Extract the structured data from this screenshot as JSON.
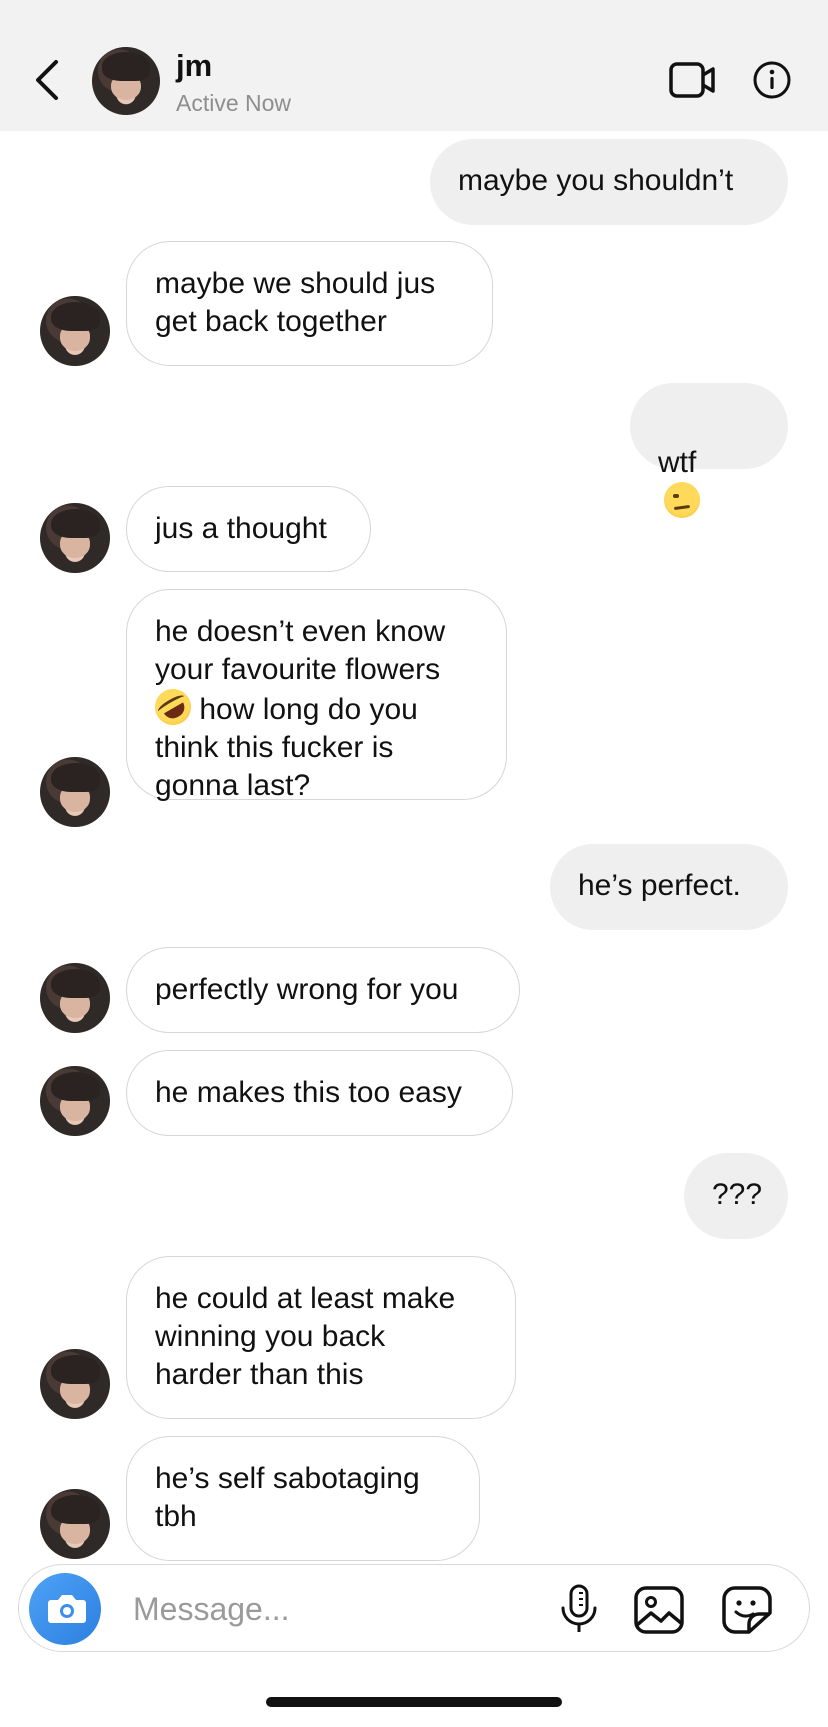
{
  "header": {
    "contact_name": "jm",
    "contact_status": "Active Now",
    "back_icon": "chevron-left-icon",
    "video_icon": "video-camera-icon",
    "info_icon": "info-icon"
  },
  "messages": [
    {
      "direction": "outgoing",
      "text": "maybe you shouldn’t"
    },
    {
      "direction": "incoming",
      "text": "maybe we should jus\nget back together"
    },
    {
      "direction": "outgoing",
      "text": "wtf",
      "emoji": "raised-eyebrow-emoji"
    },
    {
      "direction": "incoming",
      "text": "jus a thought"
    },
    {
      "direction": "incoming",
      "text_before_emoji": "he doesn’t even know\nyour favourite flowers\n",
      "emoji": "rofl-emoji",
      "text_after_emoji": " how long do you\nthink this fucker is\ngonna last?"
    },
    {
      "direction": "outgoing",
      "text": "he’s perfect."
    },
    {
      "direction": "incoming",
      "text": "perfectly wrong for you"
    },
    {
      "direction": "incoming",
      "text": "he makes this too easy"
    },
    {
      "direction": "outgoing",
      "text": "???"
    },
    {
      "direction": "incoming",
      "text": "he could at least make\nwinning you back\nharder than this"
    },
    {
      "direction": "incoming",
      "text": "he’s self sabotaging\ntbh"
    }
  ],
  "composer": {
    "placeholder": "Message...",
    "value": "",
    "camera_icon": "camera-icon",
    "mic_icon": "microphone-icon",
    "gallery_icon": "gallery-icon",
    "sticker_icon": "sticker-icon"
  },
  "colors": {
    "header_bg": "#f2f2f3",
    "outgoing_bubble": "#efefef",
    "incoming_border": "#d6d6d6",
    "camera_button": "#3b8ff0",
    "status_text": "#8e8e8e"
  }
}
